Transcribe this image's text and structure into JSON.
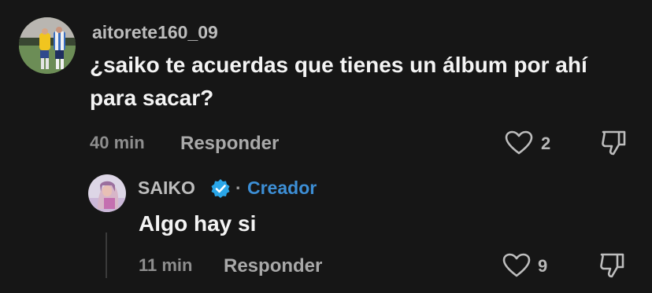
{
  "comments": [
    {
      "username": "aitorete160_09",
      "text": "¿saiko te acuerdas que tienes un álbum por ahí para sacar?",
      "time": "40 min",
      "reply_label": "Responder",
      "likes": "2",
      "avatar_icon": "user-photo-avatar"
    }
  ],
  "reply": {
    "username": "SAIKO",
    "verified": true,
    "separator": "·",
    "badge": "Creador",
    "text": "Algo hay si",
    "time": "11 min",
    "reply_label": "Responder",
    "likes": "9",
    "avatar_icon": "user-photo-avatar"
  },
  "colors": {
    "background": "#161616",
    "creator": "#3d8fd6",
    "verified": "#2aa6e8"
  },
  "icons": {
    "like": "heart-icon",
    "dislike": "thumbs-down-icon",
    "verified": "verified-badge-icon"
  }
}
